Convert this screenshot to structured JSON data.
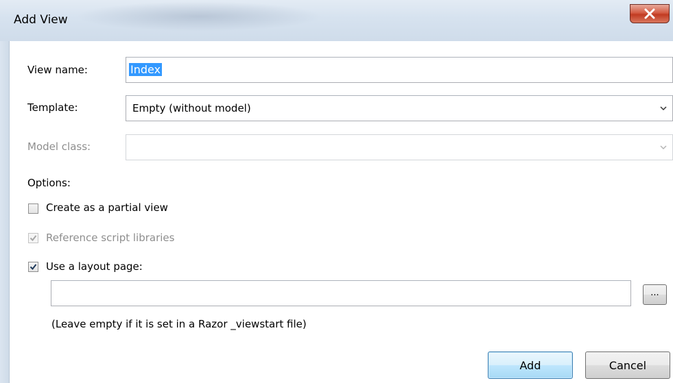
{
  "window": {
    "title": "Add View",
    "close_icon": "close-icon",
    "close_glyph": "X",
    "close_color": "#c13b22"
  },
  "form": {
    "view_name": {
      "label": "View name:",
      "value": "Index"
    },
    "template": {
      "label": "Template:",
      "value": "Empty (without model)"
    },
    "model_class": {
      "label": "Model class:",
      "value": ""
    },
    "options_label": "Options:",
    "partial_view": {
      "label": "Create as a partial view",
      "checked": false
    },
    "script_libraries": {
      "label": "Reference script libraries",
      "checked": true,
      "disabled": true
    },
    "layout_page": {
      "label": "Use a layout page:",
      "checked": true,
      "value": ""
    },
    "browse_label": "...",
    "layout_hint": "(Leave empty if it is set in a Razor _viewstart file)"
  },
  "buttons": {
    "add": "Add",
    "cancel": "Cancel"
  },
  "icons": {
    "dropdown": "chevron-down-icon",
    "check": "check-icon"
  },
  "colors": {
    "selection": "#3399ff",
    "accent_button": "#3c7fb1"
  }
}
